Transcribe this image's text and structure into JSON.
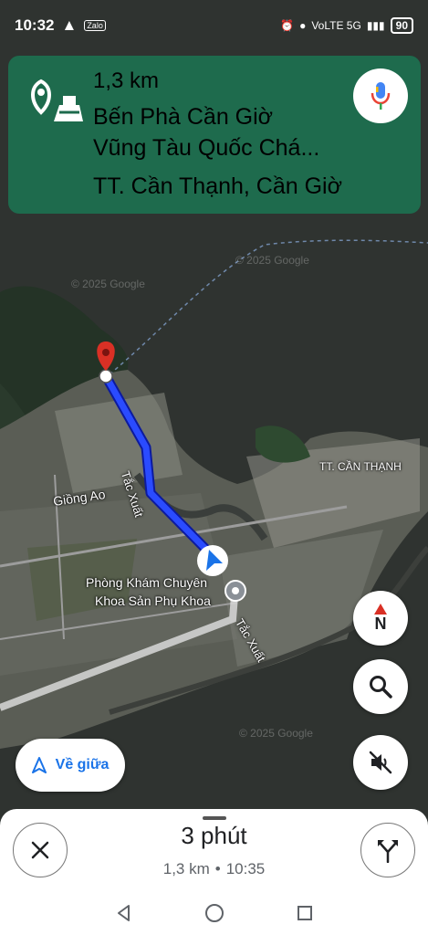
{
  "status_bar": {
    "time": "10:32",
    "zalo": "Zalo",
    "network": "VoLTE 5G",
    "battery": "90"
  },
  "navigation": {
    "distance": "1,3 km",
    "destination_line1": "Bến Phà Cần Giờ",
    "destination_line2": "Vũng Tàu Quốc Chá...",
    "destination_line3": "TT. Cần Thạnh, Cần Giờ",
    "turn_icon": "destination-ferry-icon",
    "mic_icon": "microphone-icon"
  },
  "map": {
    "labels": {
      "road_tac_xuat_1": "Tắc Xuất",
      "road_tac_xuat_2": "Tắc Xuất",
      "giong_ao": "Giồng Ao",
      "town": "TT. CẦN THẠNH",
      "clinic_line1": "Phòng Khám Chuyên",
      "clinic_line2": "Khoa Sản Phụ Khoa"
    },
    "watermark": "© 2025 Google",
    "route_color": "#1a3fff"
  },
  "controls": {
    "compass_label": "N",
    "recenter_label": "Về giữa",
    "search_icon": "search-icon",
    "mute_icon": "mute-icon"
  },
  "trip": {
    "duration": "3 phút",
    "distance": "1,3 km",
    "separator": "•",
    "arrival": "10:35"
  },
  "colors": {
    "header_green": "#1e6b4d",
    "accent_blue": "#1a73e8",
    "pin_red": "#d93025"
  }
}
